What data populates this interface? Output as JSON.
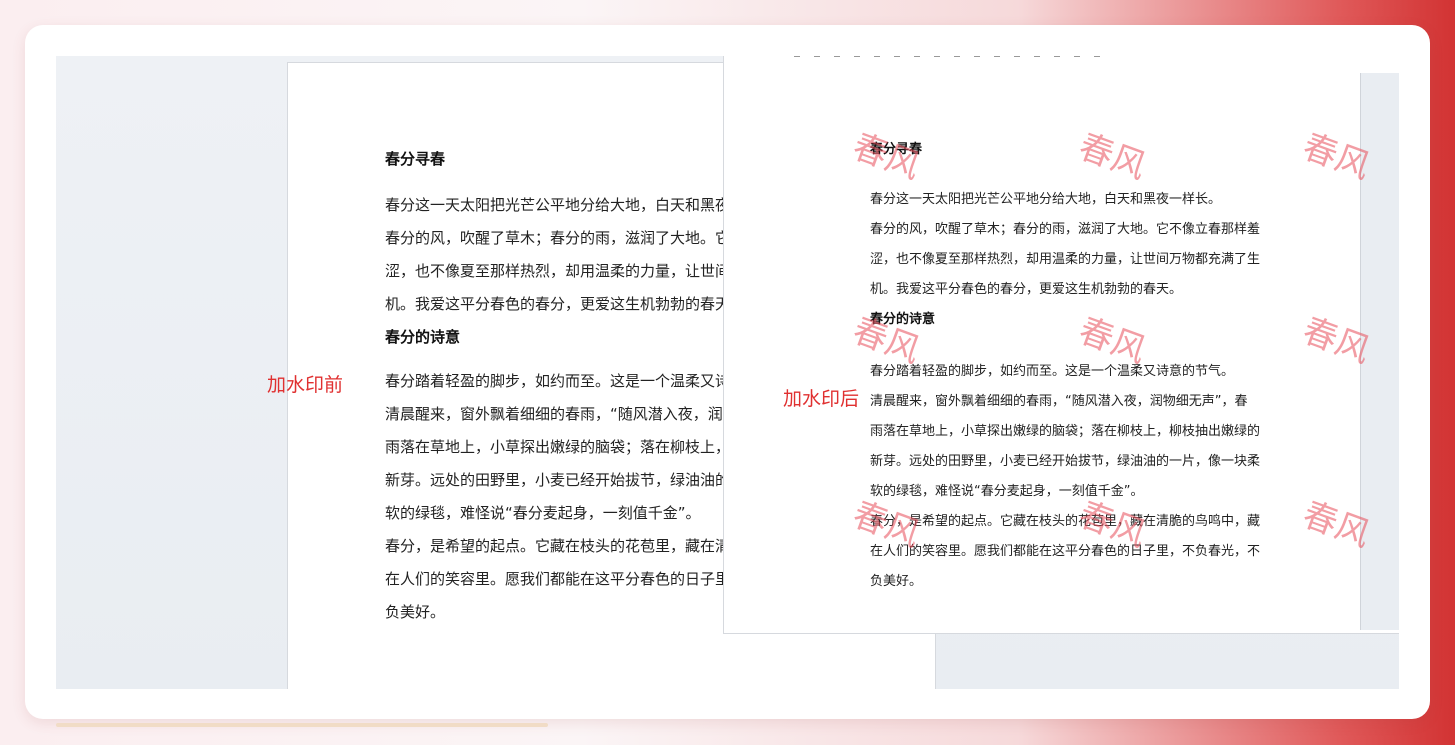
{
  "labels": {
    "before": "加水印前",
    "after": "加水印后"
  },
  "watermark_text": "春风",
  "before_doc": {
    "title1": "春分寻春",
    "p1_lines": [
      "春分这一天太阳把光芒公平地分给大地，白天和黑夜",
      "春分的风，吹醒了草木；春分的雨，滋润了大地。它",
      "涩，也不像夏至那样热烈，却用温柔的力量，让世间",
      "机。我爱这平分春色的春分，更爱这生机勃勃的春天"
    ],
    "title2": "春分的诗意",
    "p2_lines": [
      "春分踏着轻盈的脚步，如约而至。这是一个温柔又诗",
      "清晨醒来，窗外飘着细细的春雨，“随风潜入夜，润",
      "雨落在草地上，小草探出嫩绿的脑袋；落在柳枝上，",
      "新芽。远处的田野里，小麦已经开始拔节，绿油油的",
      "软的绿毯，难怪说“春分麦起身，一刻值千金”。",
      "春分，是希望的起点。它藏在枝头的花苞里，藏在清",
      "在人们的笑容里。愿我们都能在这平分春色的日子里",
      "负美好。"
    ]
  },
  "after_doc": {
    "title1": "春分寻春",
    "p1_lines": [
      "春分这一天太阳把光芒公平地分给大地，白天和黑夜一样长。",
      "春分的风，吹醒了草木；春分的雨，滋润了大地。它不像立春那样羞",
      "涩，也不像夏至那样热烈，却用温柔的力量，让世间万物都充满了生",
      "机。我爱这平分春色的春分，更爱这生机勃勃的春天。"
    ],
    "title2": "春分的诗意",
    "p2_lines": [
      "春分踏着轻盈的脚步，如约而至。这是一个温柔又诗意的节气。",
      "清晨醒来，窗外飘着细细的春雨，“随风潜入夜，润物细无声”，春",
      "雨落在草地上，小草探出嫩绿的脑袋；落在柳枝上，柳枝抽出嫩绿的",
      "新芽。远处的田野里，小麦已经开始拔节，绿油油的一片，像一块柔",
      "软的绿毯，难怪说“春分麦起身，一刻值千金”。",
      "春分，是希望的起点。它藏在枝头的花苞里，藏在清脆的鸟鸣中，藏",
      "在人们的笑容里。愿我们都能在这平分春色的日子里，不负春光，不",
      "负美好。"
    ]
  }
}
